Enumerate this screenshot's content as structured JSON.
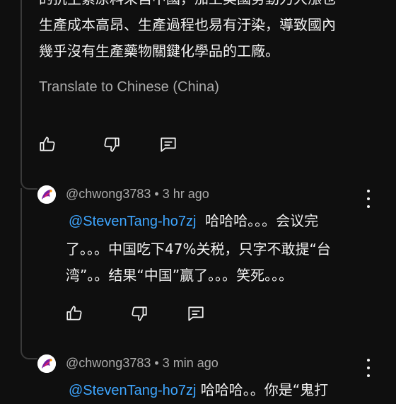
{
  "parent_comment": {
    "lines": [
      "的抗生素原料來自中國，加上美國勞動力大漲也",
      "生產成本高昂、生產過程也易有汙染，導致國內",
      "幾乎沒有生產藥物關鍵化學品的工廠。"
    ],
    "translate_label": "Translate to Chinese (China)"
  },
  "replies": [
    {
      "author": "@chwong3783",
      "separator": "•",
      "time": "3 hr ago",
      "mention": "@StevenTang-ho7zj",
      "first_line_rest": "哈哈哈。。。会议完",
      "lines": [
        "了。。。中国吃下47%关税，只字不敢提“台",
        "湾”。。结果“中国”赢了。。。笑死。。。"
      ]
    },
    {
      "author": "@chwong3783",
      "separator": "•",
      "time": "3 min ago",
      "mention": "@StevenTang-ho7zj",
      "first_line_rest": "哈哈哈。。你是“鬼打"
    }
  ],
  "icons": {
    "like": "thumbs-up-icon",
    "dislike": "thumbs-down-icon",
    "reply": "comment-icon",
    "more": "more-vert-icon"
  },
  "colors": {
    "background": "#0f0f0f",
    "text": "#f1f1f1",
    "secondary": "#aaaaaa",
    "mention": "#3ea6ff"
  }
}
